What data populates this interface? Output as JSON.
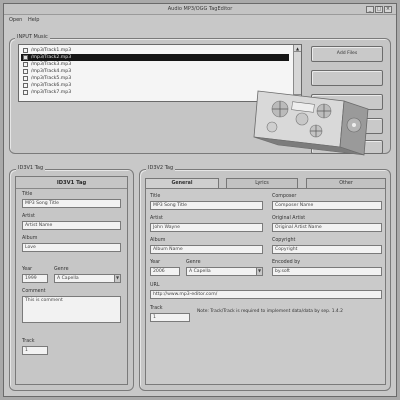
{
  "window": {
    "title": "Audio MP3/OGG TagEditor",
    "min_glyph": "_",
    "max_glyph": "□",
    "close_glyph": "×"
  },
  "menu": {
    "items": [
      "Open",
      "Help"
    ]
  },
  "input_music": {
    "label": "INPUT Music",
    "files": [
      "/mp3/Track1.mp3",
      "/mp3/Track2.mp3",
      "/mp3/Track3.mp3",
      "/mp3/Track4.mp3",
      "/mp3/Track5.mp3",
      "/mp3/Track6.mp3",
      "/mp3/Track7.mp3"
    ],
    "selected_index": 1,
    "scroll_up": "▲",
    "scroll_down": "▼",
    "add_button": "Add Files"
  },
  "id3v1": {
    "group_label": "ID3V1 Tag",
    "header": "ID3V1 Tag",
    "title_label": "Title",
    "title_value": "MP3 Song Title",
    "artist_label": "Artist",
    "artist_value": "Artist Name",
    "album_label": "Album",
    "album_value": "Love",
    "year_label": "Year",
    "year_value": "1999",
    "genre_label": "Genre",
    "genre_value": "A Capella",
    "comment_label": "Comment",
    "comment_value": "This is comment",
    "track_label": "Track",
    "track_value": "1"
  },
  "id3v2": {
    "group_label": "ID3V2 Tag",
    "tabs": [
      "General",
      "Lyrics",
      "Other"
    ],
    "title_label": "Title",
    "title_value": "MP3 Song Title",
    "composer_label": "Composer",
    "composer_value": "Composer Name",
    "artist_label": "Artist",
    "artist_value": "John Wayne",
    "orig_artist_label": "Original Artist",
    "orig_artist_value": "Original Artist Name",
    "album_label": "Album",
    "album_value": "Album Name",
    "copyright_label": "Copyright",
    "copyright_value": "Copyright",
    "year_label": "Year",
    "year_value": "2006",
    "genre_label": "Genre",
    "genre_value": "A Capella",
    "encoded_label": "Encoded by",
    "encoded_value": "by.soft",
    "url_label": "URL",
    "url_value": "http://www.mp3-editor.com/",
    "track_label": "Track",
    "track_value": "1",
    "note": "Note: Track/Track is required to implement data/data by sep. 1.4.2"
  },
  "colors": {
    "selection": "#151515",
    "window_bg": "#c8c8c8"
  }
}
